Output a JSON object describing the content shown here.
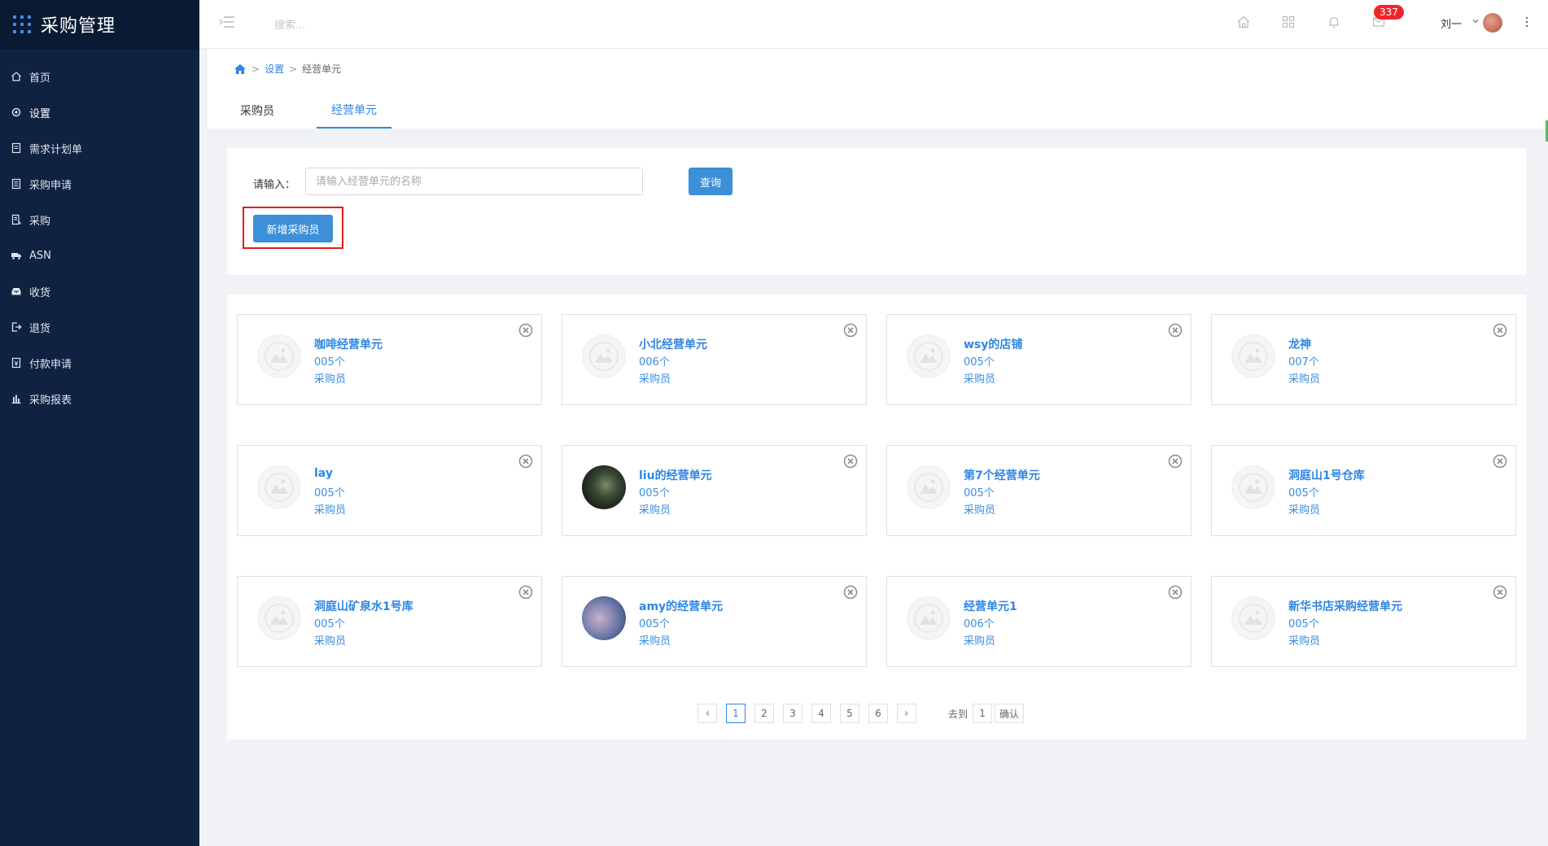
{
  "app": {
    "title": "采购管理"
  },
  "sidebar": {
    "items": [
      {
        "label": "首页",
        "icon": "home-icon"
      },
      {
        "label": "设置",
        "icon": "gear-icon",
        "active": true
      },
      {
        "label": "需求计划单",
        "icon": "document-icon"
      },
      {
        "label": "采购申请",
        "icon": "list-icon"
      },
      {
        "label": "采购",
        "icon": "cart-icon"
      },
      {
        "label": "ASN",
        "icon": "truck-icon"
      },
      {
        "label": "收货",
        "icon": "inbox-icon"
      },
      {
        "label": "退货",
        "icon": "return-icon"
      },
      {
        "label": "付款申请",
        "icon": "payment-icon"
      },
      {
        "label": "采购报表",
        "icon": "bar-chart-icon"
      }
    ]
  },
  "header": {
    "search_placeholder": "搜索...",
    "badge_count": "337",
    "user_name": "刘一"
  },
  "breadcrumb": {
    "settings": "设置",
    "current": "经营单元"
  },
  "tabs": [
    {
      "label": "采购员",
      "active": false
    },
    {
      "label": "经营单元",
      "active": true
    }
  ],
  "search": {
    "label": "请输入：",
    "placeholder": "请输入经营单元的名称",
    "query_button": "查询",
    "add_button": "新增采购员"
  },
  "cards": [
    {
      "title": "咖啡经营单元",
      "count": "005个",
      "role": "采购员",
      "avatar": "placeholder"
    },
    {
      "title": "小北经营单元",
      "count": "006个",
      "role": "采购员",
      "avatar": "placeholder"
    },
    {
      "title": "wsy的店铺",
      "count": "005个",
      "role": "采购员",
      "avatar": "placeholder"
    },
    {
      "title": "龙神",
      "count": "007个",
      "role": "采购员",
      "avatar": "placeholder"
    },
    {
      "title": "lay",
      "count": "005个",
      "role": "采购员",
      "avatar": "placeholder"
    },
    {
      "title": "liu的经营单元",
      "count": "005个",
      "role": "采购员",
      "avatar": "photo1"
    },
    {
      "title": "第7个经营单元",
      "count": "005个",
      "role": "采购员",
      "avatar": "placeholder"
    },
    {
      "title": "洞庭山1号仓库",
      "count": "005个",
      "role": "采购员",
      "avatar": "placeholder"
    },
    {
      "title": "洞庭山矿泉水1号库",
      "count": "005个",
      "role": "采购员",
      "avatar": "placeholder"
    },
    {
      "title": "amy的经营单元",
      "count": "005个",
      "role": "采购员",
      "avatar": "photo2"
    },
    {
      "title": "经营单元1",
      "count": "006个",
      "role": "采购员",
      "avatar": "placeholder"
    },
    {
      "title": "新华书店采购经营单元",
      "count": "005个",
      "role": "采购员",
      "avatar": "placeholder"
    }
  ],
  "pagination": {
    "pages": [
      "1",
      "2",
      "3",
      "4",
      "5",
      "6"
    ],
    "current": "1",
    "goto_label": "去到",
    "goto_value": "1",
    "confirm_label": "确认"
  },
  "colors": {
    "sidebar_bg": "#0f2240",
    "accent": "#2f86e4",
    "button": "#3d8fd8",
    "badge": "#f0262a",
    "highlight": "#e31c1c"
  }
}
